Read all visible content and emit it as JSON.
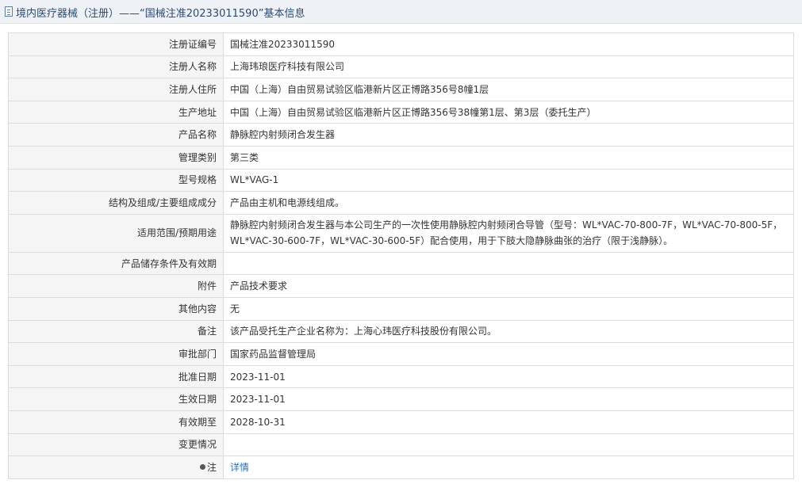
{
  "header": {
    "title": "境内医疗器械（注册）——“国械注准20233011590”基本信息"
  },
  "rows": [
    {
      "label": "注册证编号",
      "value": "国械注准20233011590"
    },
    {
      "label": "注册人名称",
      "value": "上海玮琅医疗科技有限公司"
    },
    {
      "label": "注册人住所",
      "value": "中国（上海）自由贸易试验区临港新片区正博路356号8幢1层"
    },
    {
      "label": "生产地址",
      "value": "中国（上海）自由贸易试验区临港新片区正博路356号38幢第1层、第3层（委托生产）"
    },
    {
      "label": "产品名称",
      "value": "静脉腔内射频闭合发生器"
    },
    {
      "label": "管理类别",
      "value": "第三类"
    },
    {
      "label": "型号规格",
      "value": "WL*VAG-1"
    },
    {
      "label": "结构及组成/主要组成成分",
      "value": "产品由主机和电源线组成。"
    },
    {
      "label": "适用范围/预期用途",
      "value": "静脉腔内射频闭合发生器与本公司生产的一次性使用静脉腔内射频闭合导管（型号：WL*VAC-70-800-7F，WL*VAC-70-800-5F，WL*VAC-30-600-7F，WL*VAC-30-600-5F）配合使用，用于下肢大隐静脉曲张的治疗（限于浅静脉）。"
    },
    {
      "label": "产品储存条件及有效期",
      "value": ""
    },
    {
      "label": "附件",
      "value": "产品技术要求"
    },
    {
      "label": "其他内容",
      "value": "无"
    },
    {
      "label": "备注",
      "value": "该产品受托生产企业名称为：上海心玮医疗科技股份有限公司。"
    },
    {
      "label": "审批部门",
      "value": "国家药品监督管理局"
    },
    {
      "label": "批准日期",
      "value": "2023-11-01"
    },
    {
      "label": "生效日期",
      "value": "2023-11-01"
    },
    {
      "label": "有效期至",
      "value": "2028-10-31"
    },
    {
      "label": "变更情况",
      "value": ""
    }
  ],
  "note_row": {
    "label": "注",
    "link": "详情"
  },
  "icons": {
    "header": "document-icon",
    "note": "pin-icon"
  },
  "colors": {
    "link": "#2f6fc0",
    "header_text": "#2c4a73",
    "label_bg": "#f5f5f5"
  }
}
